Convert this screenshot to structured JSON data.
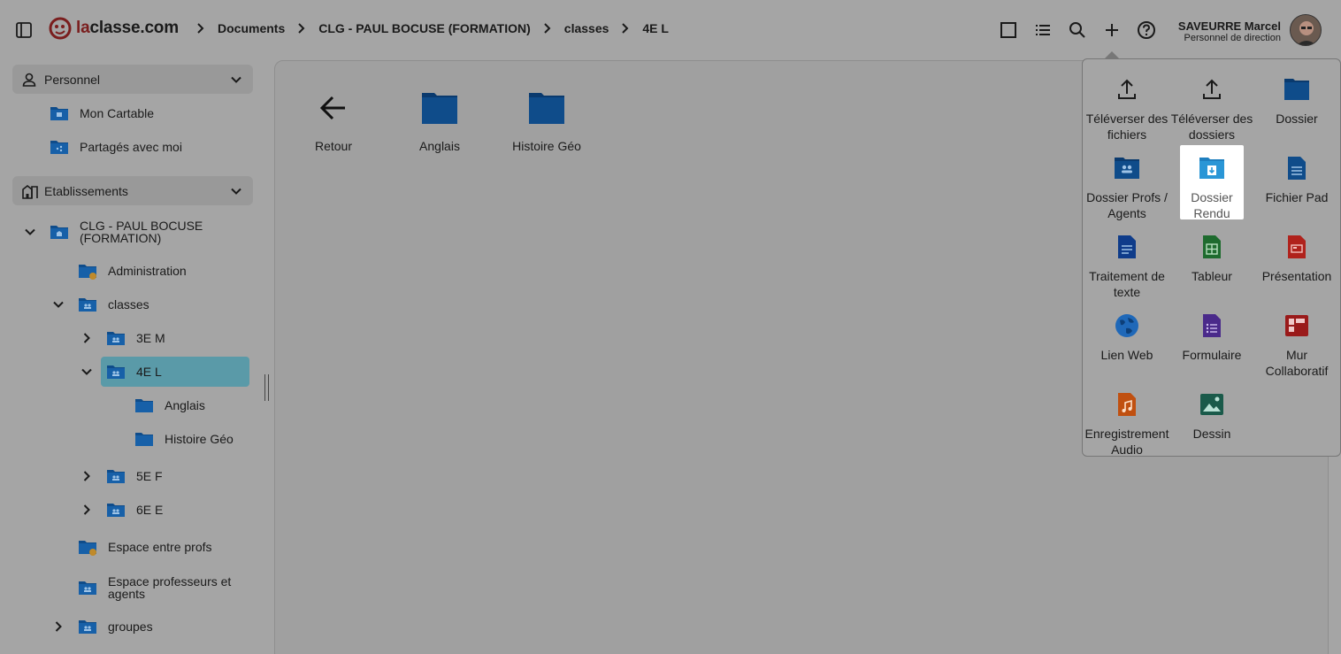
{
  "header": {
    "logo_text_accent": "la",
    "logo_text_rest": "classe.com",
    "breadcrumb": [
      "Documents",
      "CLG - PAUL BOCUSE (FORMATION)",
      "classes",
      "4E L"
    ],
    "user_name": "SAVEURRE Marcel",
    "user_role": "Personnel de direction"
  },
  "sidebar": {
    "personnel": {
      "label": "Personnel",
      "items": [
        "Mon Cartable",
        "Partagés avec moi"
      ]
    },
    "etablissements": {
      "label": "Etablissements",
      "school": "CLG - PAUL BOCUSE (FORMATION)",
      "items": {
        "administration": "Administration",
        "classes": "classes",
        "c3em": "3E M",
        "c4el": "4E L",
        "anglais": "Anglais",
        "histoire": "Histoire Géo",
        "c5ef": "5E F",
        "c6ee": "6E E",
        "espace_profs": "Espace entre profs",
        "espace_prof_agents": "Espace professeurs et agents",
        "groupes": "groupes"
      }
    }
  },
  "main": {
    "tiles": [
      "Retour",
      "Anglais",
      "Histoire Géo"
    ]
  },
  "menu": {
    "items": [
      {
        "label": "Téléverser des fichiers",
        "icon": "upload-icon"
      },
      {
        "label": "Téléverser des dossiers",
        "icon": "upload-icon"
      },
      {
        "label": "Dossier",
        "icon": "folder-icon"
      },
      {
        "label": "Dossier Profs / Agents",
        "icon": "folder-users-icon"
      },
      {
        "label": "Dossier Rendu",
        "icon": "folder-drop-icon"
      },
      {
        "label": "Fichier Pad",
        "icon": "pad-file-icon"
      },
      {
        "label": "Traitement de texte",
        "icon": "document-icon"
      },
      {
        "label": "Tableur",
        "icon": "spreadsheet-icon"
      },
      {
        "label": "Présentation",
        "icon": "presentation-icon"
      },
      {
        "label": "Lien Web",
        "icon": "globe-icon"
      },
      {
        "label": "Formulaire",
        "icon": "form-icon"
      },
      {
        "label": "Mur Collaboratif",
        "icon": "board-icon"
      },
      {
        "label": "Enregistrement Audio",
        "icon": "audio-icon"
      },
      {
        "label": "Dessin",
        "icon": "image-icon"
      }
    ]
  },
  "colors": {
    "folder": "#0f4c8a",
    "folder_dark": "#0a3a6e",
    "selected": "#5a9aa8",
    "logo_red": "#7a1e1e",
    "sheet_green": "#1e6b2e",
    "pres_red": "#b0221c",
    "form_purple": "#4a2a8a",
    "audio_orange": "#c05010"
  }
}
